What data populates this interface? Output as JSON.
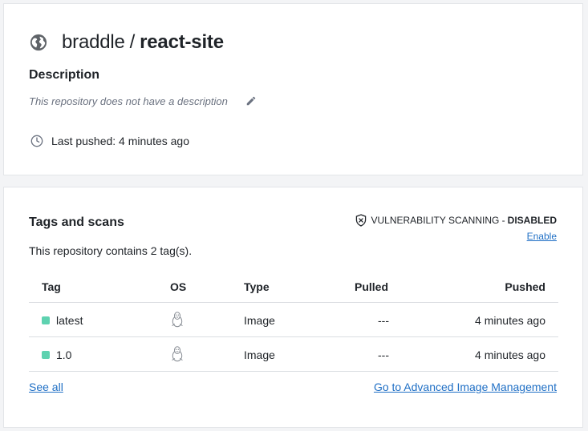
{
  "repo": {
    "namespace": "braddle",
    "separator": "/",
    "name": "react-site",
    "description_heading": "Description",
    "description_text": "This repository does not have a description",
    "last_pushed": "Last pushed: 4 minutes ago",
    "icon": "globe-icon"
  },
  "tags": {
    "heading": "Tags and scans",
    "vuln_label": "VULNERABILITY SCANNING -",
    "vuln_status": "DISABLED",
    "enable_label": "Enable",
    "count_text": "This repository contains 2 tag(s).",
    "columns": {
      "tag": "Tag",
      "os": "OS",
      "type": "Type",
      "pulled": "Pulled",
      "pushed": "Pushed"
    },
    "rows": [
      {
        "tag": "latest",
        "os_icon": "linux-icon",
        "type": "Image",
        "pulled": "---",
        "pushed": "4 minutes ago"
      },
      {
        "tag": "1.0",
        "os_icon": "linux-icon",
        "type": "Image",
        "pulled": "---",
        "pushed": "4 minutes ago"
      }
    ],
    "see_all": "See all",
    "advanced_link": "Go to Advanced Image Management"
  },
  "colors": {
    "link": "#1f6fc5",
    "tag_dot": "#5ed2b0",
    "icon_gray": "#6b7280"
  }
}
